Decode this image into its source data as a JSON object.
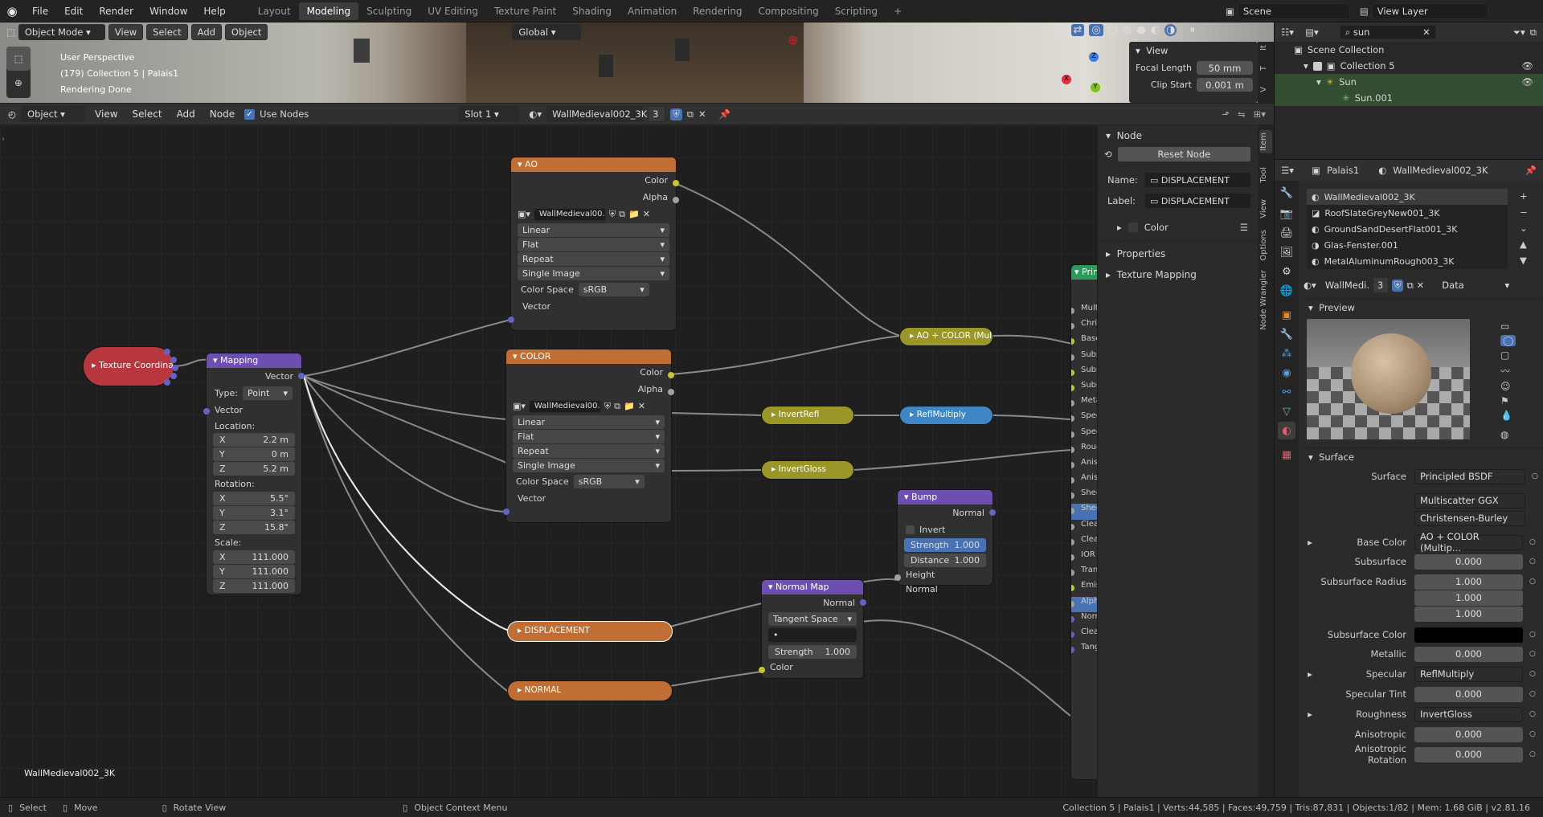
{
  "menu": [
    "File",
    "Edit",
    "Render",
    "Window",
    "Help"
  ],
  "workspaces": [
    "Layout",
    "Modeling",
    "Sculpting",
    "UV Editing",
    "Texture Paint",
    "Shading",
    "Animation",
    "Rendering",
    "Compositing",
    "Scripting"
  ],
  "active_workspace": "Modeling",
  "scene": "Scene",
  "view_layer": "View Layer",
  "viewport": {
    "mode": "Object Mode",
    "menus": [
      "View",
      "Select",
      "Add",
      "Object"
    ],
    "orientation": "Global",
    "info1": "User Perspective",
    "info2": "(179) Collection 5 | Palais1",
    "info3": "Rendering Done",
    "view_panel": {
      "title": "View",
      "focal_label": "Focal Length",
      "focal_value": "50 mm",
      "clip_label": "Clip Start",
      "clip_value": "0.001 m"
    }
  },
  "node_header": {
    "mode": "Object",
    "menus": [
      "View",
      "Select",
      "Add",
      "Node"
    ],
    "use_nodes": "Use Nodes",
    "slot": "Slot 1",
    "material": "WallMedieval002_3K",
    "users": "3"
  },
  "nodes": {
    "ao": {
      "title": "AO",
      "out1": "Color",
      "out2": "Alpha",
      "image": "WallMedieval00...",
      "interp": "Linear",
      "proj": "Flat",
      "ext": "Repeat",
      "source": "Single Image",
      "cs_label": "Color Space",
      "cs": "sRGB",
      "in": "Vector"
    },
    "color": {
      "title": "COLOR",
      "out1": "Color",
      "out2": "Alpha",
      "image": "WallMedieval00...",
      "interp": "Linear",
      "proj": "Flat",
      "ext": "Repeat",
      "source": "Single Image",
      "cs_label": "Color Space",
      "cs": "sRGB",
      "in": "Vector"
    },
    "texcoord": "Texture Coordinat",
    "mapping": {
      "title": "Mapping",
      "out": "Vector",
      "type_label": "Type:",
      "type": "Point",
      "in": "Vector",
      "loc": "Location:",
      "rot": "Rotation:",
      "scale": "Scale:",
      "lx": "2.2 m",
      "ly": "0 m",
      "lz": "5.2 m",
      "rx": "5.5°",
      "ry": "3.1°",
      "rz": "15.8°",
      "sx": "111.000",
      "sy": "111.000",
      "sz": "111.000"
    },
    "aocolor": "AO + COLOR (Mul...",
    "invertrefl": "InvertRefl",
    "reflmul": "ReflMultiply",
    "invertgloss": "InvertGloss",
    "bump": {
      "title": "Bump",
      "out": "Normal",
      "invert": "Invert",
      "strength_label": "Strength",
      "strength": "1.000",
      "distance_label": "Distance",
      "distance": "1.000",
      "height": "Height",
      "normal": "Normal"
    },
    "normalmap": {
      "title": "Normal Map",
      "out": "Normal",
      "space": "Tangent Space",
      "uv": "•",
      "strength_label": "Strength",
      "strength": "1.000",
      "color": "Color"
    },
    "displacement": "DISPLACEMENT",
    "normal": "NORMAL",
    "bsdf": {
      "title": "Prin",
      "inputs": [
        "Mult",
        "Chris",
        "Base",
        "Subs",
        "Subs",
        "Subs",
        "Meta",
        "Spec",
        "Spec",
        "Roug",
        "Anis",
        "Anis",
        "Shee",
        "Shee",
        "Clea",
        "Clea",
        "IOR",
        "Tran",
        "Emis",
        "Alph",
        "Norm",
        "Clea",
        "Tang"
      ]
    }
  },
  "editor_label": "WallMedieval002_3K",
  "npanel": {
    "section": "Node",
    "reset": "Reset Node",
    "name_label": "Name:",
    "name": "DISPLACEMENT",
    "label_label": "Label:",
    "label": "DISPLACEMENT",
    "color": "Color",
    "properties": "Properties",
    "texmap": "Texture Mapping"
  },
  "ntabs": [
    "Item",
    "Tool",
    "View",
    "Options",
    "Node Wrangler"
  ],
  "vp_tabs": [
    "It",
    "T",
    "V"
  ],
  "outliner": {
    "search": "sun",
    "items": [
      "Scene Collection",
      "Collection 5",
      "Sun",
      "Sun.001"
    ]
  },
  "props": {
    "object": "Palais1",
    "material": "WallMedieval002_3K",
    "materials": [
      "WallMedieval002_3K",
      "RoofSlateGreyNew001_3K",
      "GroundSandDesertFlat001_3K",
      "Glas-Fenster.001",
      "MetalAluminumRough003_3K"
    ],
    "mat_field": "WallMedi...",
    "mat_users": "3",
    "link": "Data",
    "preview": "Preview",
    "surface_section": "Surface",
    "rows": [
      {
        "label": "Surface",
        "value": "Principled BSDF"
      },
      {
        "label": "",
        "value": "Multiscatter GGX"
      },
      {
        "label": "",
        "value": "Christensen-Burley"
      },
      {
        "label": "Base Color",
        "value": "AO + COLOR (Multip..."
      },
      {
        "label": "Subsurface",
        "value": "0.000"
      },
      {
        "label": "Subsurface Radius",
        "value": "1.000"
      },
      {
        "label": "",
        "value": "1.000"
      },
      {
        "label": "",
        "value": "1.000"
      },
      {
        "label": "Subsurface Color",
        "value": ""
      },
      {
        "label": "Metallic",
        "value": "0.000"
      },
      {
        "label": "Specular",
        "value": "ReflMultiply"
      },
      {
        "label": "Specular Tint",
        "value": "0.000"
      },
      {
        "label": "Roughness",
        "value": "InvertGloss"
      },
      {
        "label": "Anisotropic",
        "value": "0.000"
      },
      {
        "label": "Anisotropic Rotation",
        "value": "0.000"
      }
    ]
  },
  "status": {
    "select": "Select",
    "move": "Move",
    "rotate": "Rotate View",
    "context": "Object Context Menu",
    "stats": "Collection 5 | Palais1 | Verts:44,585 | Faces:49,759 | Tris:87,831 | Objects:1/82 | Mem: 1.68 GiB | v2.81.16"
  },
  "colors": {
    "accent": "#4772b3",
    "node_texture": "#c06e33",
    "node_vector": "#6c4fb1",
    "node_color": "#9a9728",
    "socket_yellow": "#c7c729",
    "socket_purple": "#6363c7"
  }
}
